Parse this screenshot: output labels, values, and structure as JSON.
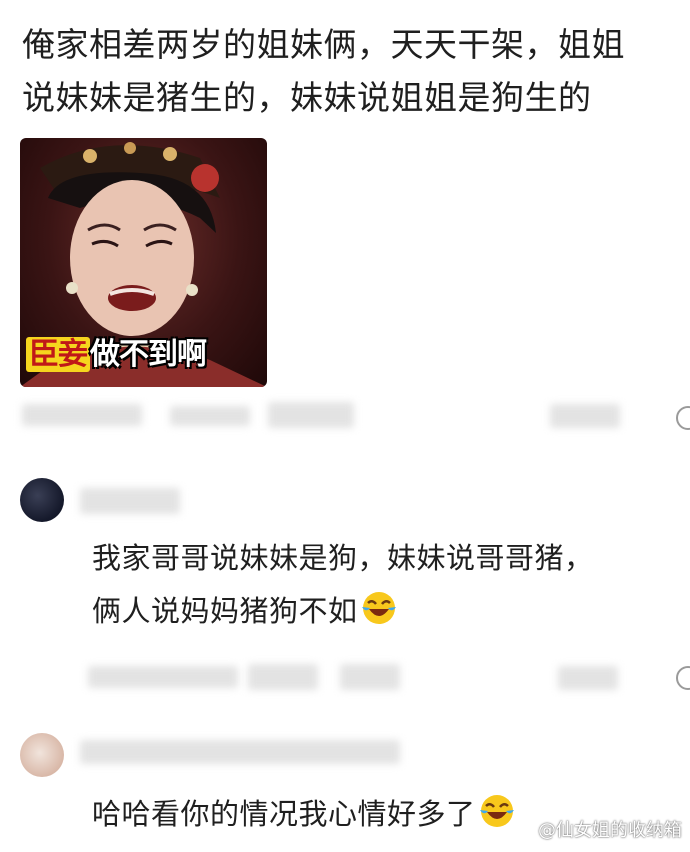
{
  "post": {
    "line1": "俺家相差两岁的姐妹俩，天天干架，姐姐",
    "line2": "说妹妹是猪生的，妹妹说姐姐是狗生的"
  },
  "meme": {
    "caption_highlight": "臣妾",
    "caption_rest": "做不到啊"
  },
  "comments": [
    {
      "line1": "我家哥哥说妹妹是狗，妹妹说哥哥猪，",
      "line2": "俩人说妈妈猪狗不如",
      "emoji": "rofl-emoji"
    },
    {
      "line1": "哈哈看你的情况我心情好多了",
      "emoji": "rofl-emoji"
    }
  ],
  "watermark": "@仙女姐的收纳箱",
  "colors": {
    "caption_highlight_bg": "#f6d51e",
    "caption_highlight_text": "#c01818",
    "blur_gray": "#e3e3e3"
  }
}
